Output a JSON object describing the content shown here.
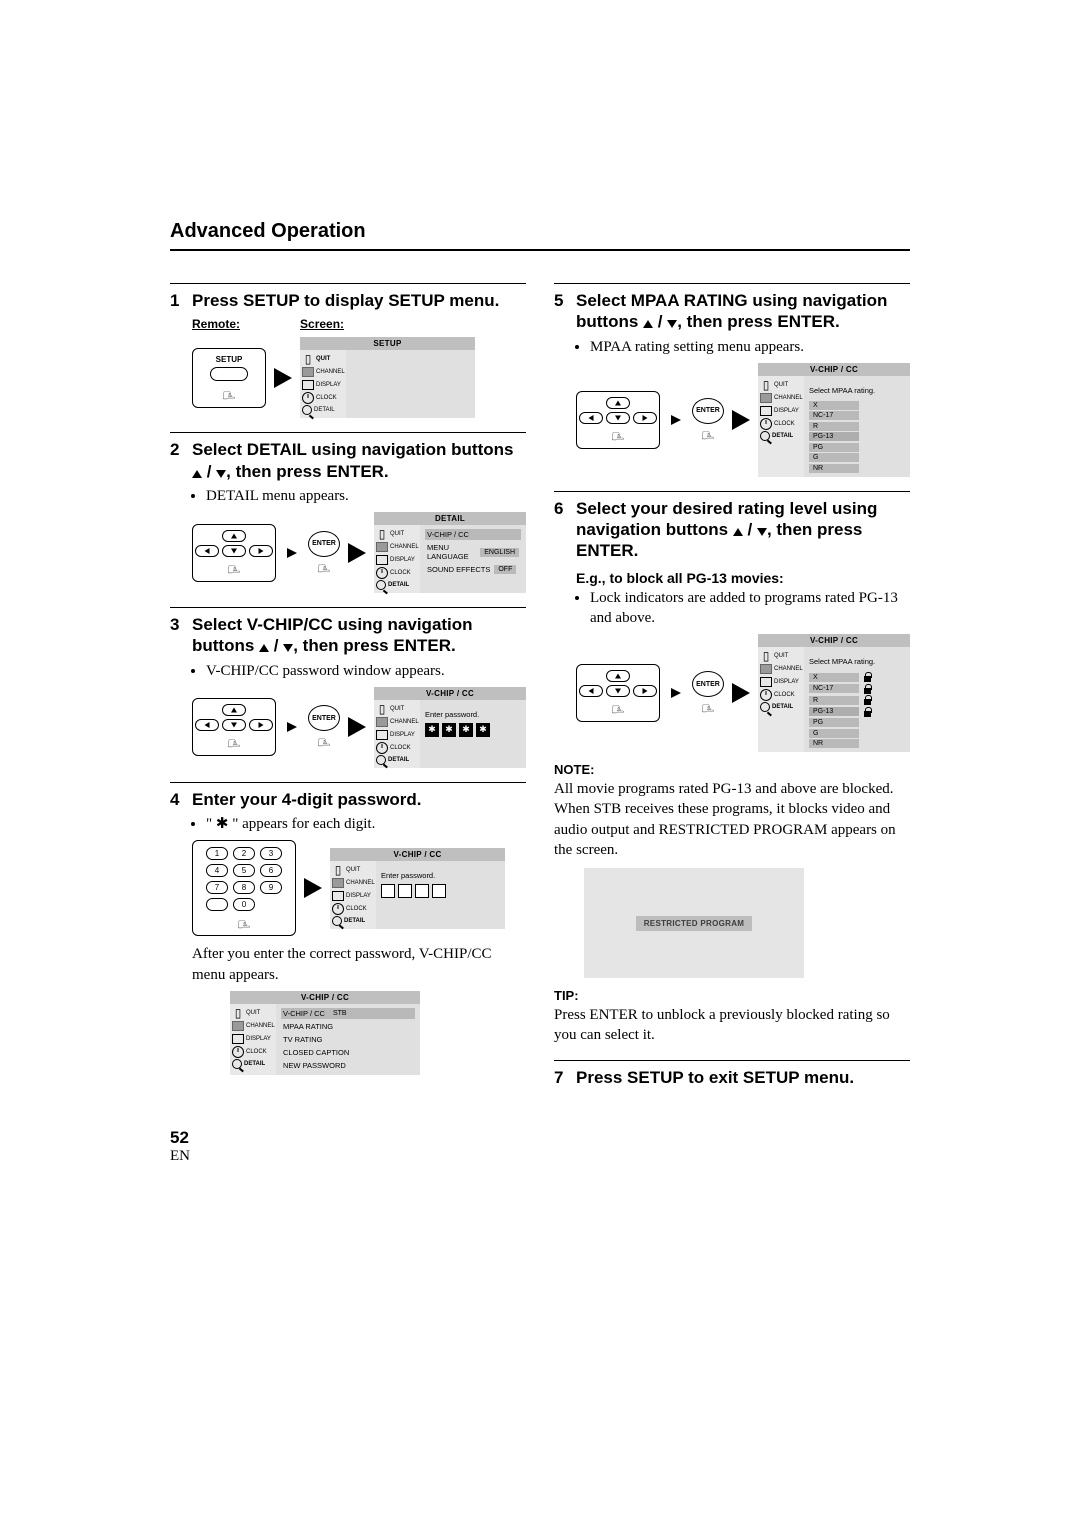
{
  "section_title": "Advanced Operation",
  "page_number": "52",
  "page_lang": "EN",
  "arrows_sep": " / ",
  "step1": {
    "num": "1",
    "title": "Press SETUP to display SETUP menu.",
    "remote_label": "Remote:",
    "screen_label": "Screen:",
    "remote_btn": "SETUP",
    "osd_title": "SETUP",
    "side": {
      "quit": "QUIT",
      "channel": "CHANNEL",
      "display": "DISPLAY",
      "clock": "CLOCK",
      "detail": "DETAIL"
    }
  },
  "step2": {
    "num": "2",
    "title_a": "Select DETAIL using navigation buttons ",
    "title_b": ", then press ENTER.",
    "bullet": "DETAIL menu appears.",
    "enter": "ENTER",
    "osd_title": "DETAIL",
    "rows": [
      {
        "k": "V-CHIP / CC",
        "v": ""
      },
      {
        "k": "MENU LANGUAGE",
        "v": "ENGLISH"
      },
      {
        "k": "SOUND EFFECTS",
        "v": "OFF"
      }
    ]
  },
  "step3": {
    "num": "3",
    "title_a": "Select V-CHIP/CC using navigation buttons ",
    "title_b": ", then press ENTER.",
    "bullet": "V-CHIP/CC password window appears.",
    "enter": "ENTER",
    "osd_title": "V-CHIP / CC",
    "prompt": "Enter password.",
    "filled": [
      true,
      true,
      true,
      true
    ]
  },
  "step4": {
    "num": "4",
    "title": "Enter your 4-digit password.",
    "bullet_a": "\"  ",
    "bullet_star": "✱",
    "bullet_b": "  \" appears for each digit.",
    "osd_title": "V-CHIP / CC",
    "prompt": "Enter password.",
    "filled": [
      false,
      false,
      false,
      false
    ],
    "after_text": "After you enter the correct password, V-CHIP/CC menu appears.",
    "osd2_title": "V-CHIP / CC",
    "osd2_rows": [
      {
        "k": "V-CHIP / CC",
        "v": "STB",
        "hl": true
      },
      {
        "k": "MPAA RATING",
        "v": ""
      },
      {
        "k": "TV RATING",
        "v": ""
      },
      {
        "k": "CLOSED CAPTION",
        "v": ""
      },
      {
        "k": "NEW PASSWORD",
        "v": ""
      }
    ]
  },
  "step5": {
    "num": "5",
    "title_a": "Select MPAA RATING using navigation buttons ",
    "title_b": ", then press ENTER.",
    "bullet": "MPAA rating setting menu appears.",
    "enter": "ENTER",
    "osd_title": "V-CHIP / CC",
    "prompt": "Select MPAA rating.",
    "ratings": [
      {
        "r": "X",
        "lock": false
      },
      {
        "r": "NC-17",
        "lock": false
      },
      {
        "r": "R",
        "lock": false
      },
      {
        "r": "PG-13",
        "lock": false,
        "hl": true
      },
      {
        "r": "PG",
        "lock": false
      },
      {
        "r": "G",
        "lock": false
      },
      {
        "r": "NR",
        "lock": false
      }
    ]
  },
  "step6": {
    "num": "6",
    "title_a": "Select your desired rating level using navigation buttons ",
    "title_b": ", then press ENTER.",
    "eg_head": "E.g., to block all PG-13 movies:",
    "eg_bullet": "Lock indicators are added to programs rated PG-13 and above.",
    "enter": "ENTER",
    "osd_title": "V-CHIP / CC",
    "prompt": "Select MPAA rating.",
    "ratings": [
      {
        "r": "X",
        "lock": true
      },
      {
        "r": "NC-17",
        "lock": true
      },
      {
        "r": "R",
        "lock": true
      },
      {
        "r": "PG-13",
        "lock": true,
        "hl": true
      },
      {
        "r": "PG",
        "lock": false
      },
      {
        "r": "G",
        "lock": false
      },
      {
        "r": "NR",
        "lock": false
      }
    ],
    "note_head": "NOTE:",
    "note_body": "All movie programs rated PG-13 and above are blocked. When STB receives these programs, it blocks video and audio output and RESTRICTED PROGRAM appears on the screen.",
    "restricted": "RESTRICTED PROGRAM",
    "tip_head": "TIP:",
    "tip_body": "Press ENTER to unblock a previously blocked rating so you can select it."
  },
  "step7": {
    "num": "7",
    "title": "Press SETUP to exit SETUP menu."
  },
  "side_labels": {
    "quit": "QUIT",
    "channel": "CHANNEL",
    "display": "DISPLAY",
    "clock": "CLOCK",
    "detail": "DETAIL"
  },
  "keypad": {
    "keys": [
      "1",
      "2",
      "3",
      "4",
      "5",
      "6",
      "7",
      "8",
      "9",
      "",
      "0",
      ""
    ]
  }
}
